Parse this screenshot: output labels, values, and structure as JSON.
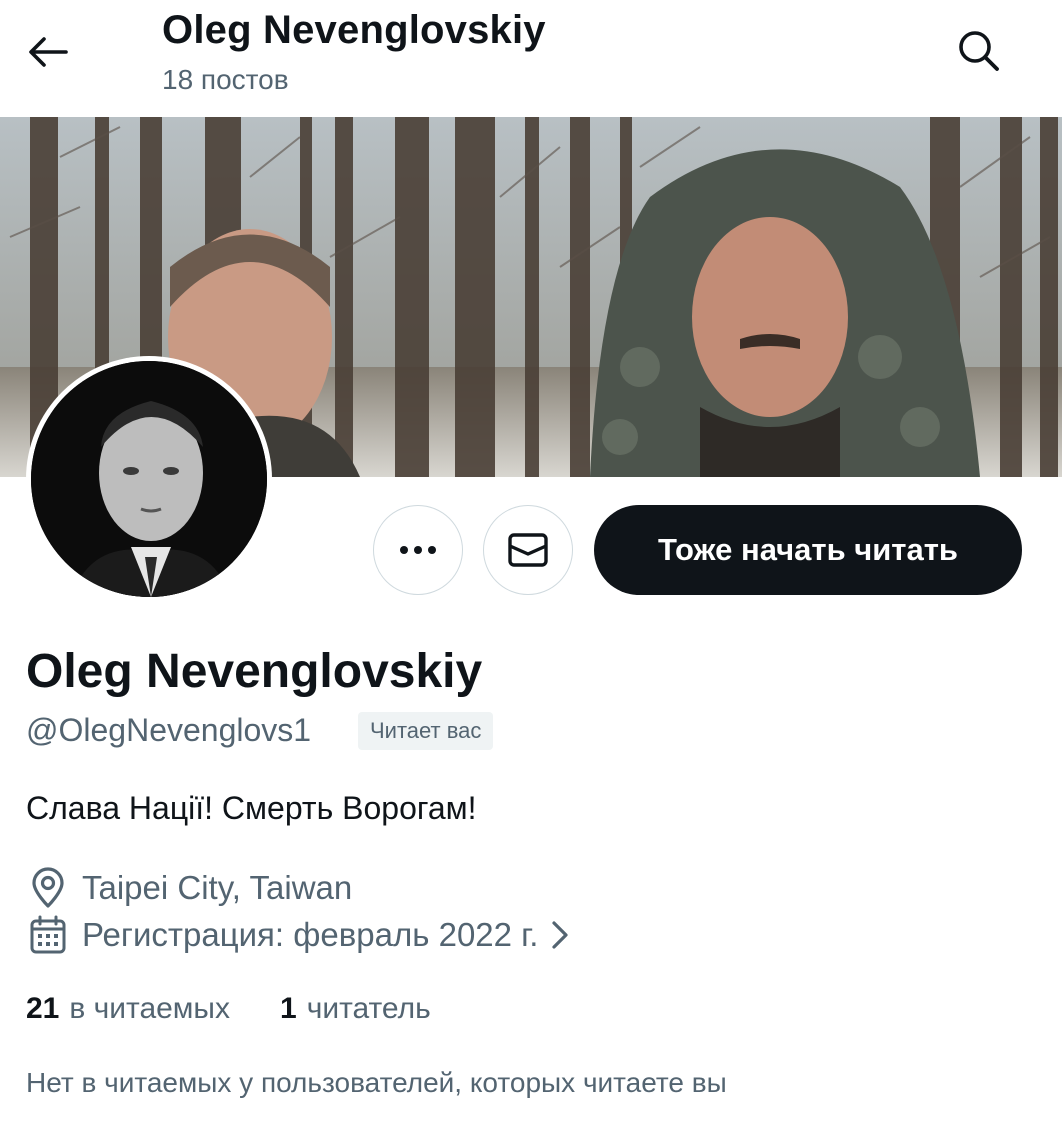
{
  "header": {
    "title": "Oleg Nevenglovskiy",
    "post_count": "18 постов",
    "back_icon": "arrow-left-icon",
    "search_icon": "search-icon"
  },
  "profile": {
    "display_name": "Oleg Nevenglovskiy",
    "handle": "@OlegNevenglovs1",
    "follows_you_badge": "Читает вас",
    "bio": "Слава Нації! Смерть Ворогам!",
    "location": "Taipei City, Taiwan",
    "joined": "Регистрация: февраль 2022 г."
  },
  "actions": {
    "more_icon": "more-horizontal-icon",
    "message_icon": "envelope-icon",
    "follow_back_label": "Тоже начать читать"
  },
  "stats": {
    "following_count": "21",
    "following_label": "в читаемых",
    "followers_count": "1",
    "followers_label": "читатель"
  },
  "mutuals_note": "Нет в читаемых у пользователей, которых читаете вы",
  "colors": {
    "text_primary": "#0f1419",
    "text_secondary": "#536471",
    "border": "#cfd9de",
    "badge_bg": "#eff3f4",
    "button_dark": "#0f1419"
  }
}
